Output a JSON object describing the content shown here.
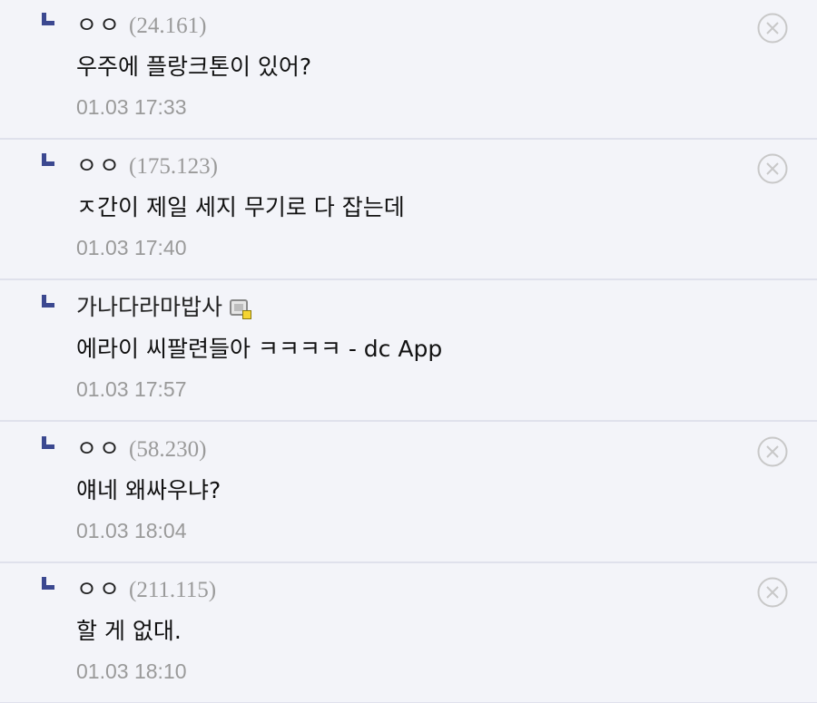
{
  "comments": [
    {
      "nick": "ㅇㅇ",
      "ip": "(24.161)",
      "text": "우주에 플랑크톤이 있어?",
      "date": "01.03 17:33",
      "member_icon": false,
      "deletable": true
    },
    {
      "nick": "ㅇㅇ",
      "ip": "(175.123)",
      "text": "ㅈ간이 제일 세지 무기로 다 잡는데",
      "date": "01.03 17:40",
      "member_icon": false,
      "deletable": true
    },
    {
      "nick": "가나다라마밥사",
      "ip": "",
      "text": "에라이 씨팔련들아 ㅋㅋㅋㅋ - dc App",
      "date": "01.03 17:57",
      "member_icon": true,
      "deletable": false
    },
    {
      "nick": "ㅇㅇ",
      "ip": "(58.230)",
      "text": "얘네 왜싸우냐?",
      "date": "01.03 18:04",
      "member_icon": false,
      "deletable": true
    },
    {
      "nick": "ㅇㅇ",
      "ip": "(211.115)",
      "text": "할 게 없대.",
      "date": "01.03 18:10",
      "member_icon": false,
      "deletable": true
    }
  ],
  "icons": {
    "reply": "reply-arrow-icon",
    "delete": "close-circle-icon",
    "member": "gallery-member-icon"
  },
  "colors": {
    "background": "#f3f4f9",
    "reply_mark": "#3b4890",
    "divider": "#dfe1ec",
    "muted_text": "#9a9a9a"
  }
}
